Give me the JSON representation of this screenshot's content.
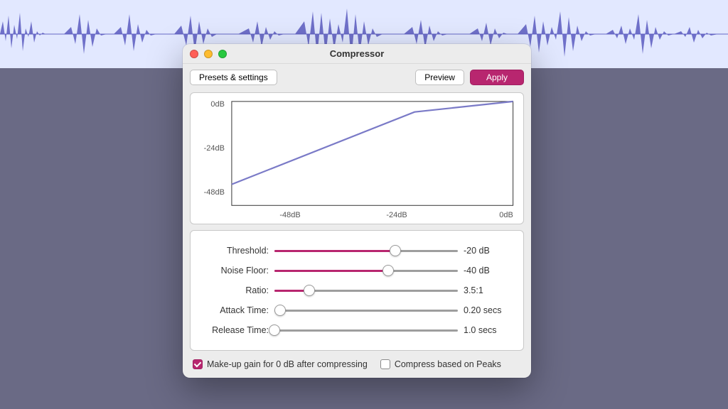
{
  "window": {
    "title": "Compressor"
  },
  "toolbar": {
    "presets_label": "Presets & settings",
    "preview_label": "Preview",
    "apply_label": "Apply"
  },
  "graph": {
    "y_ticks": [
      "0dB",
      "-24dB",
      "-48dB"
    ],
    "x_ticks": [
      "-48dB",
      "-24dB",
      "0dB"
    ]
  },
  "chart_data": {
    "type": "line",
    "title": "",
    "xlabel": "",
    "ylabel": "",
    "xlim": [
      -60,
      0
    ],
    "ylim": [
      -60,
      0
    ],
    "x_ticks": [
      -48,
      -24,
      0
    ],
    "y_ticks": [
      0,
      -24,
      -48
    ],
    "series": [
      {
        "name": "compression-curve",
        "x": [
          -60,
          -20,
          0
        ],
        "y": [
          -47,
          -6,
          0
        ]
      }
    ]
  },
  "sliders": [
    {
      "label": "Threshold:",
      "value_text": "-20 dB",
      "percent": 66,
      "accent": true
    },
    {
      "label": "Noise Floor:",
      "value_text": "-40 dB",
      "percent": 62,
      "accent": true
    },
    {
      "label": "Ratio:",
      "value_text": "3.5:1",
      "percent": 19,
      "accent": true
    },
    {
      "label": "Attack Time:",
      "value_text": "0.20 secs",
      "percent": 3,
      "accent": false
    },
    {
      "label": "Release Time:",
      "value_text": "1.0 secs",
      "percent": 0,
      "accent": false
    }
  ],
  "checkboxes": {
    "makeup_label": "Make-up gain for 0 dB after compressing",
    "makeup_checked": true,
    "peaks_label": "Compress based on Peaks",
    "peaks_checked": false
  },
  "colors": {
    "accent": "#b8266f",
    "waveform": "#5a5bc0",
    "curve": "#7a7ac7"
  }
}
